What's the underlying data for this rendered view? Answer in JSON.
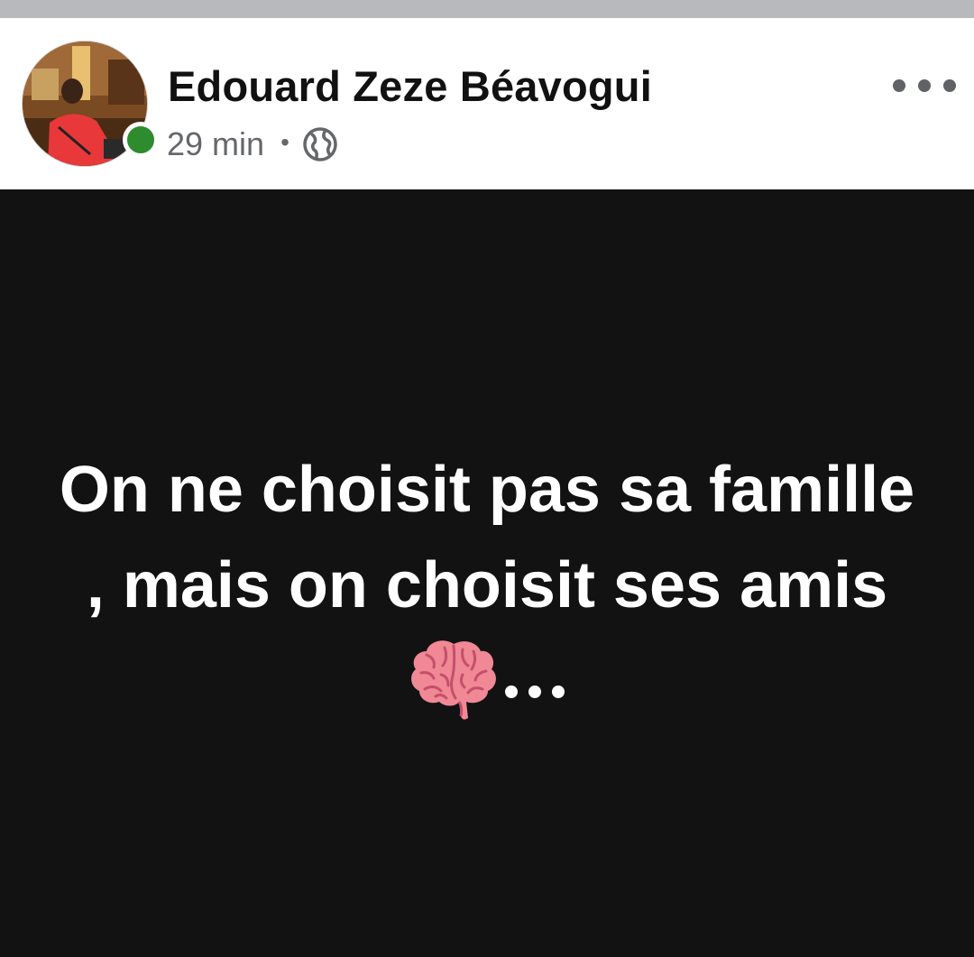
{
  "post": {
    "author_name": "Edouard Zeze Béavogui",
    "time": "29 min",
    "separator": "•",
    "privacy_icon": "globe-icon",
    "more_icon": "more-options-icon",
    "online_status": "online",
    "text_lines": [
      "On ne choisit pas sa famille",
      ", mais on choisit ses amis"
    ],
    "emoji": "brain-icon",
    "trailing_text": "..."
  },
  "colors": {
    "header_bg": "#ffffff",
    "body_bg": "#121212",
    "text": "#ffffff",
    "meta_text": "#65676b",
    "online": "#2e8b2e"
  }
}
